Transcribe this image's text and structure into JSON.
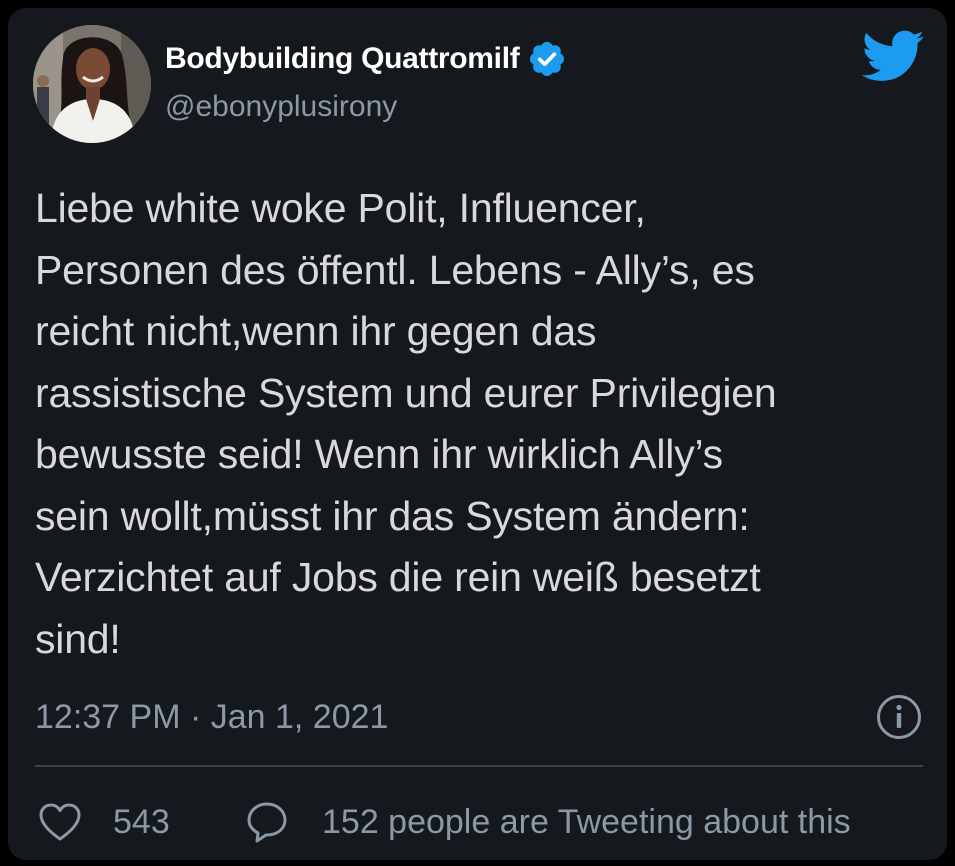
{
  "author": {
    "display_name": "Bodybuilding Quattromilf",
    "handle": "@ebonyplusirony",
    "verified": true,
    "avatar_icon": "profile-photo"
  },
  "tweet": {
    "text_lines": [
      "Liebe white woke Polit, Influencer,",
      "Personen des öffentl. Lebens - Ally’s, es",
      "reicht nicht,wenn ihr gegen das",
      "rassistische System und eurer Privilegien",
      "bewusste seid! Wenn ihr wirklich Ally’s",
      "sein wollt,müsst ihr das System ändern:",
      "Verzichtet auf Jobs die rein weiß besetzt",
      "sind!"
    ],
    "timestamp": "12:37 PM · Jan 1, 2021"
  },
  "actions": {
    "like_icon": "heart-icon",
    "like_count": "543",
    "discussion_icon": "speech-bubble-icon",
    "discussion_label": "152 people are Tweeting about this",
    "info_icon": "info-icon"
  },
  "brand": {
    "logo": "twitter-bird-icon",
    "accent": "#1d9bf0"
  },
  "colors": {
    "background": "#000000",
    "card": "#15181c",
    "text_primary": "#d9d9d9",
    "text_secondary": "#8b98a5",
    "divider": "#38444d"
  }
}
